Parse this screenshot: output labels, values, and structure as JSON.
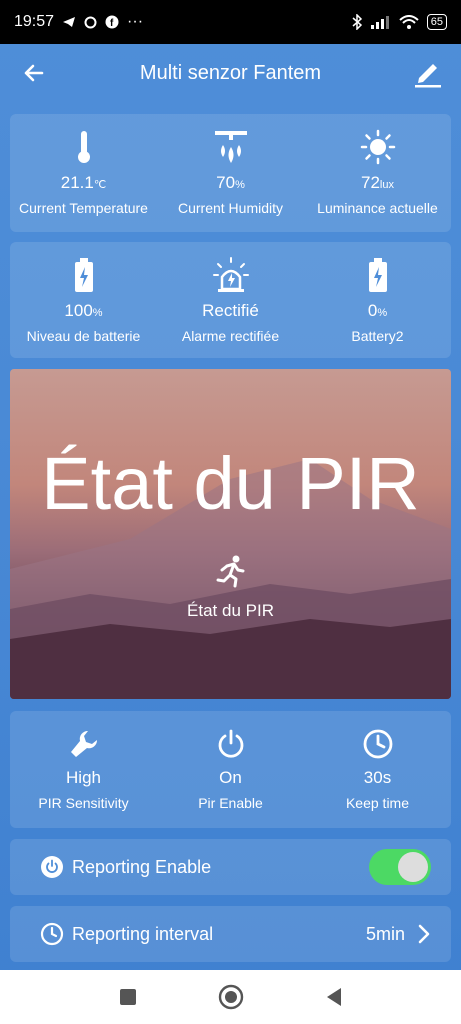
{
  "status": {
    "time": "19:57",
    "dots": "···",
    "battery": "65"
  },
  "header": {
    "title": "Multi senzor Fantem"
  },
  "sensors1": [
    {
      "icon": "thermometer-icon",
      "value": "21.1",
      "unit": "℃",
      "label": "Current Temperature"
    },
    {
      "icon": "humidity-icon",
      "value": "70",
      "unit": "%",
      "label": "Current Humidity"
    },
    {
      "icon": "sun-icon",
      "value": "72",
      "unit": "lux",
      "label": "Luminance actuelle"
    }
  ],
  "sensors2": [
    {
      "icon": "battery-icon",
      "value": "100",
      "unit": "%",
      "label": "Niveau de batterie"
    },
    {
      "icon": "alarm-icon",
      "value": "Rectifié",
      "unit": "",
      "label": "Alarme rectifiée"
    },
    {
      "icon": "battery-icon",
      "value": "0",
      "unit": "%",
      "label": "Battery2"
    }
  ],
  "hero": {
    "big_text": "État du PIR",
    "label": "État du PIR"
  },
  "settings": [
    {
      "icon": "wrench-icon",
      "value": "High",
      "label": "PIR Sensitivity"
    },
    {
      "icon": "power-icon",
      "value": "On",
      "label": "Pir Enable"
    },
    {
      "icon": "clock-icon",
      "value": "30s",
      "label": "Keep time"
    }
  ],
  "reporting_enable": {
    "label": "Reporting Enable",
    "on": true,
    "accent": "#4cd964"
  },
  "reporting_interval": {
    "label": "Reporting interval",
    "value": "5min"
  }
}
